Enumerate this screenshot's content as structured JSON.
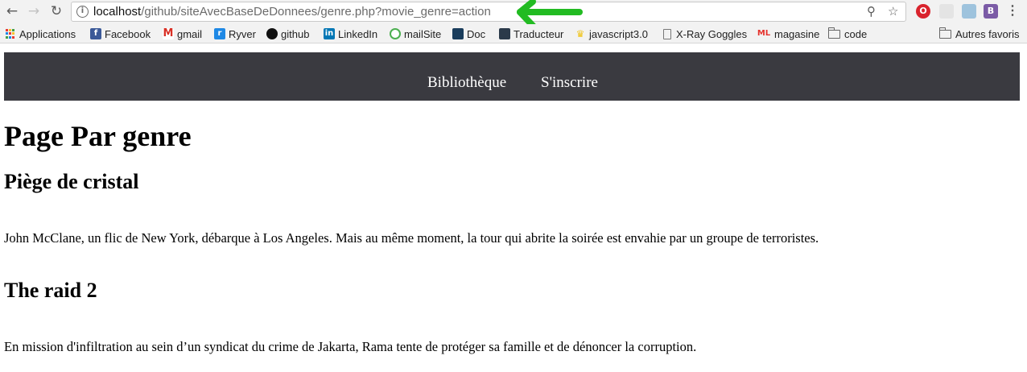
{
  "browser": {
    "url_host": "localhost",
    "url_path": "/github/siteAvecBaseDeDonnees/genre.php?movie_genre=action",
    "extensions": [
      "O",
      "B"
    ]
  },
  "bookmarks": {
    "items": [
      {
        "label": "Applications",
        "icon": "apps-grid-icon"
      },
      {
        "label": "Facebook",
        "icon": "facebook-icon",
        "color": "#3b5998"
      },
      {
        "label": "gmail",
        "icon": "gmail-icon",
        "color": "#d93025"
      },
      {
        "label": "Ryver",
        "icon": "ryver-icon",
        "color": "#1e88e5"
      },
      {
        "label": "github",
        "icon": "github-icon",
        "color": "#111111"
      },
      {
        "label": "LinkedIn",
        "icon": "linkedin-icon",
        "color": "#0077b5"
      },
      {
        "label": "mailSite",
        "icon": "mailsite-icon",
        "color": "#4caf50"
      },
      {
        "label": "Doc",
        "icon": "doc-icon",
        "color": "#1a3d5c"
      },
      {
        "label": "Traducteur",
        "icon": "translator-icon",
        "color": "#2b3a4a"
      },
      {
        "label": "javascript3.0",
        "icon": "crown-icon",
        "color": "#f0c419"
      },
      {
        "label": "X-Ray Goggles",
        "icon": "page-icon"
      },
      {
        "label": "magasine",
        "icon": "ml-icon",
        "color": "#e5322d"
      },
      {
        "label": "code",
        "icon": "folder-icon"
      }
    ],
    "other": "Autres favoris"
  },
  "site": {
    "nav": [
      "Bibliothèque",
      "S'inscrire"
    ],
    "page_title": "Page Par genre",
    "movies": [
      {
        "title": "Piège de cristal",
        "description": "John McClane, un flic de New York, débarque à Los Angeles. Mais au même moment, la tour qui abrite la soirée est envahie par un groupe de terroristes."
      },
      {
        "title": "The raid 2",
        "description": "En mission d'infiltration au sein d’un syndicat du crime de Jakarta, Rama tente de protéger sa famille et de dénoncer la corruption."
      }
    ]
  },
  "colors": {
    "nav_bg": "#3a3a40",
    "annotation_arrow": "#22bb22"
  }
}
